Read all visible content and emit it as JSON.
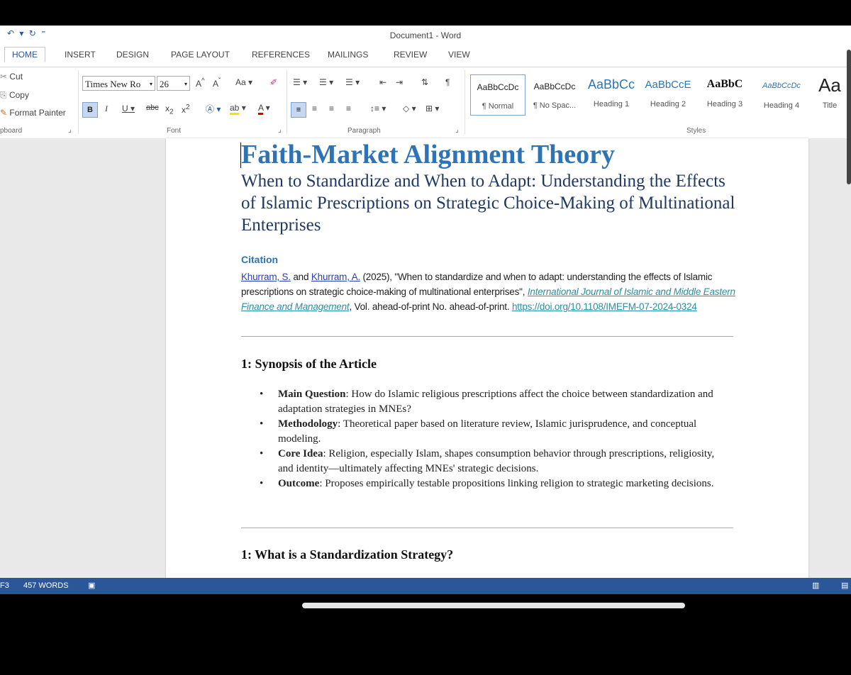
{
  "app": {
    "title": "Document1 - Word",
    "qat": "↶ ▾  ↻  ⁼"
  },
  "tabs": [
    "HOME",
    "INSERT",
    "DESIGN",
    "PAGE LAYOUT",
    "REFERENCES",
    "MAILINGS",
    "REVIEW",
    "VIEW"
  ],
  "ribbon": {
    "clipboard": {
      "cut": "Cut",
      "copy": "Copy",
      "format_painter": "Format Painter",
      "label": "pboard"
    },
    "font": {
      "name": "Times New Ro",
      "size": "26",
      "label": "Font"
    },
    "paragraph": {
      "label": "Paragraph"
    },
    "styles": {
      "label": "Styles",
      "items": [
        {
          "preview": "AaBbCcDc",
          "name": "¶ Normal"
        },
        {
          "preview": "AaBbCcDc",
          "name": "¶ No Spac..."
        },
        {
          "preview": "AaBbCc",
          "name": "Heading 1"
        },
        {
          "preview": "AaBbCcE",
          "name": "Heading 2"
        },
        {
          "preview": "AaBbC",
          "name": "Heading 3"
        },
        {
          "preview": "AaBbCcDc",
          "name": "Heading 4"
        },
        {
          "preview": "Aa",
          "name": "Title"
        }
      ]
    }
  },
  "document": {
    "title": "Faith-Market Alignment Theory",
    "subtitle": "When to Standardize and When to Adapt: Understanding the Effects of Islamic Prescriptions on Strategic Choice-Making of Multinational Enterprises",
    "citation_heading": "Citation",
    "citation": {
      "author1": "Khurram, S.",
      "and": " and ",
      "author2": "Khurram, A.",
      "text1": " (2025), \"When to standardize and when to adapt: understanding the effects of Islamic prescriptions on strategic choice-making of multinational enterprises\", ",
      "journal": "International Journal of Islamic and Middle Eastern Finance and Management",
      "text2": ", Vol. ahead-of-print No. ahead-of-print. ",
      "doi": "https://doi.org/10.1108/IMEFM-07-2024-0324"
    },
    "synopsis_heading": "1: Synopsis of the Article",
    "bullets": [
      {
        "label": "Main Question",
        "text": ": How do Islamic religious prescriptions affect the choice between standardization and adaptation strategies in MNEs?"
      },
      {
        "label": "Methodology",
        "text": ": Theoretical paper based on literature review, Islamic jurisprudence, and conceptual modeling."
      },
      {
        "label": "Core Idea",
        "text": ": Religion, especially Islam, shapes consumption behavior through prescriptions, religiosity, and identity—ultimately affecting MNEs' strategic decisions."
      },
      {
        "label": "Outcome",
        "text": ": Proposes empirically testable propositions linking religion to strategic marketing decisions."
      }
    ],
    "standardization_heading": "1: What is a Standardization Strategy?"
  },
  "status": {
    "page": "3",
    "words": "457 WORDS"
  }
}
